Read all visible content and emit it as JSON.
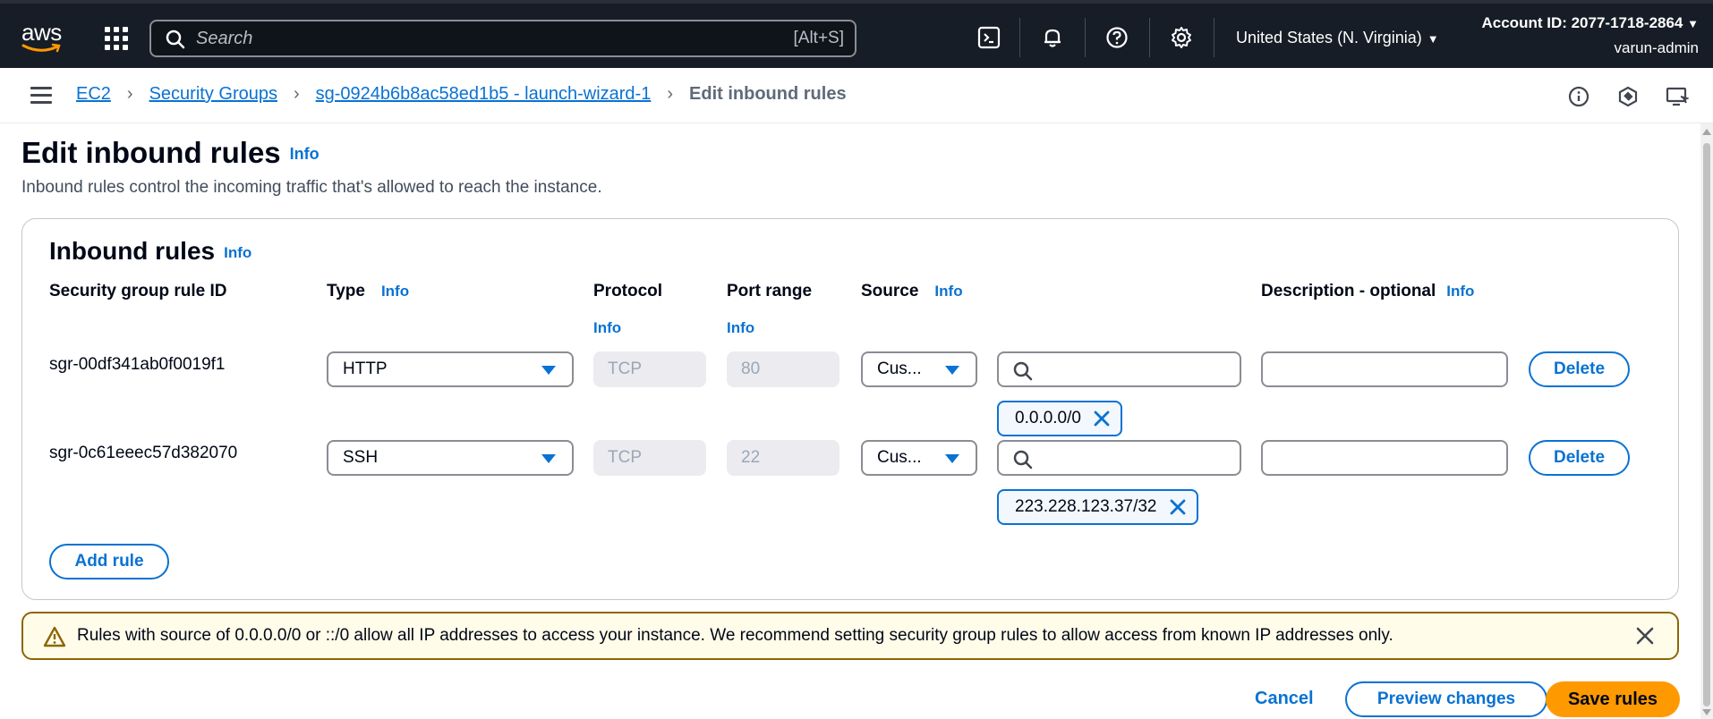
{
  "topnav": {
    "logo_text": "aws",
    "search": {
      "placeholder": "Search",
      "shortcut": "[Alt+S]"
    },
    "region": "United States (N. Virginia)",
    "account_id": "Account ID: 2077-1718-2864",
    "user": "varun-admin",
    "icons": [
      "aws-logo",
      "services-grid-icon",
      "search-icon",
      "cloudshell-icon",
      "bell-icon",
      "help-icon",
      "gear-icon"
    ]
  },
  "breadcrumb": {
    "items": [
      "EC2",
      "Security Groups",
      "sg-0924b6b8ac58ed1b5 - launch-wizard-1"
    ],
    "current": "Edit inbound rules"
  },
  "page": {
    "title": "Edit inbound rules",
    "info": "Info",
    "description": "Inbound rules control the incoming traffic that's allowed to reach the instance."
  },
  "panel": {
    "title": "Inbound rules",
    "info": "Info",
    "columns": {
      "rule_id": "Security group rule ID",
      "type": "Type",
      "protocol": "Protocol",
      "port_range": "Port range",
      "source": "Source",
      "description": "Description - optional"
    },
    "rules": [
      {
        "id": "sgr-00df341ab0f0019f1",
        "type": "HTTP",
        "protocol": "TCP",
        "port": "80",
        "source_type": "Cus...",
        "source_token": "0.0.0.0/0",
        "description": "",
        "delete": "Delete"
      },
      {
        "id": "sgr-0c61eeec57d382070",
        "type": "SSH",
        "protocol": "TCP",
        "port": "22",
        "source_type": "Cus...",
        "source_token": "223.228.123.37/32",
        "description": "",
        "delete": "Delete"
      }
    ],
    "add_rule": "Add rule"
  },
  "warning": {
    "text": "Rules with source of 0.0.0.0/0 or ::/0 allow all IP addresses to access your instance. We recommend setting security group rules to allow access from known IP addresses only."
  },
  "footer": {
    "cancel": "Cancel",
    "preview": "Preview changes",
    "save": "Save rules"
  },
  "colors": {
    "nav_bg": "#161d26",
    "link": "#0972d3",
    "primary": "#ff9900",
    "warning_border": "#8d6605",
    "warning_bg": "#fffce9"
  }
}
